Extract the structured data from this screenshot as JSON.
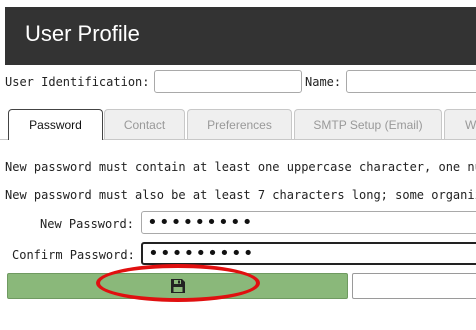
{
  "header": {
    "title": "User Profile"
  },
  "form": {
    "user_identification_label": "User Identification:",
    "user_identification_value": "",
    "name_label": "Name:",
    "name_value": ""
  },
  "tabs": [
    {
      "label": "Password",
      "active": true
    },
    {
      "label": "Contact",
      "active": false
    },
    {
      "label": "Preferences",
      "active": false
    },
    {
      "label": "SMTP Setup (Email)",
      "active": false
    },
    {
      "label": "W",
      "active": false
    }
  ],
  "password_section": {
    "help_line_1": "New password must contain at least one uppercase character, one nu",
    "help_line_2": "New password must also be at least 7 characters long; some organiz",
    "new_password_label": "New Password:",
    "new_password_value": "•••••••••",
    "confirm_password_label": "Confirm Password:",
    "confirm_password_value": "•••••••••"
  },
  "buttons": {
    "save_icon": "floppy-disk-icon"
  },
  "colors": {
    "header_bg": "#333333",
    "save_button": "#8ab87a",
    "highlight": "#e01010"
  }
}
